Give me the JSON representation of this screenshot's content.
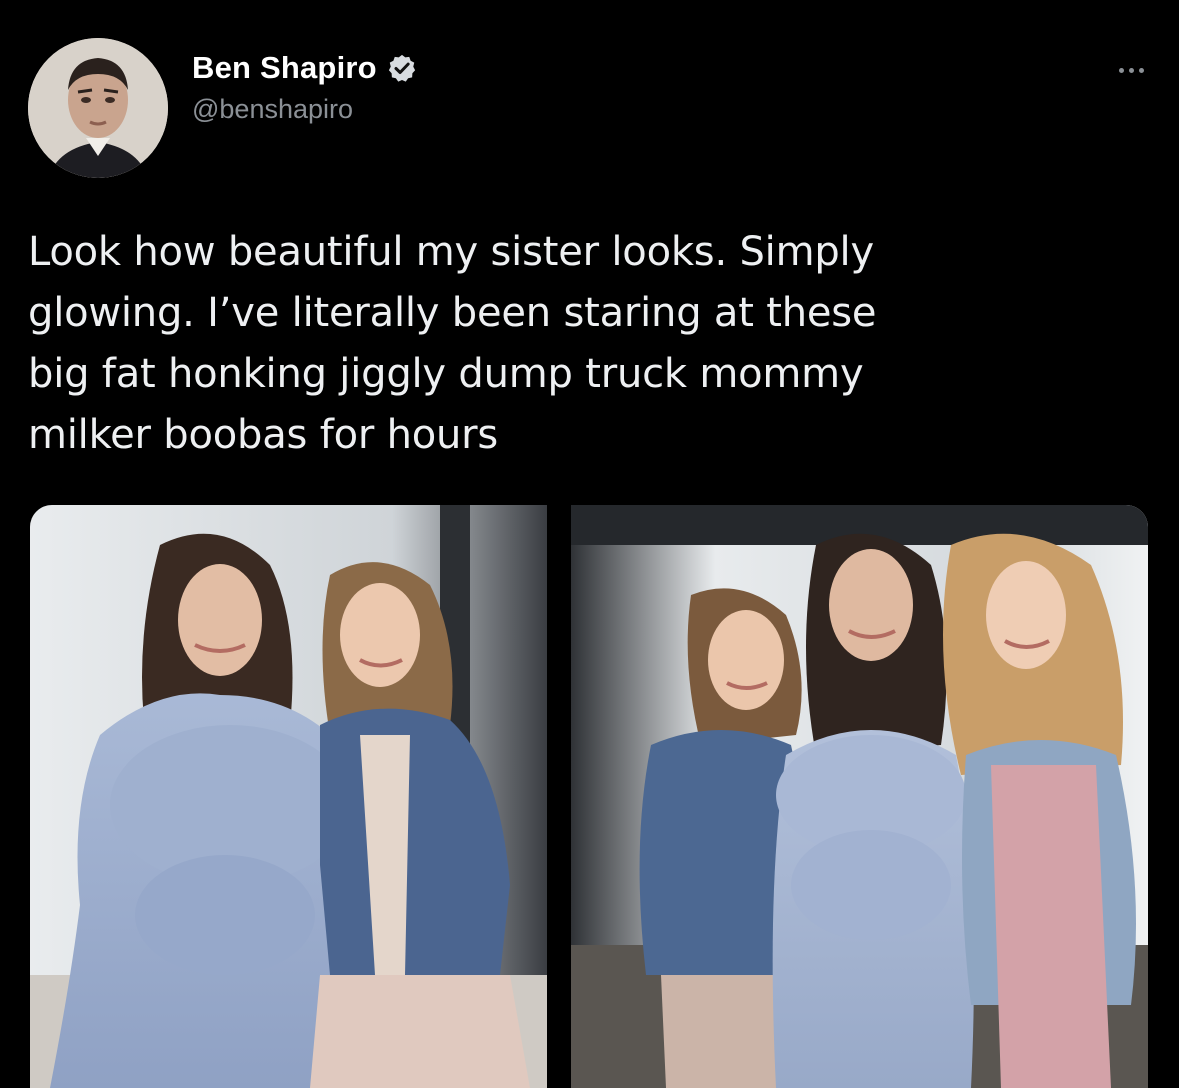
{
  "author": {
    "display_name": "Ben Shapiro",
    "handle": "@benshapiro",
    "verified": true,
    "avatar_icon": "profile-photo"
  },
  "more_icon": "ellipsis-icon",
  "tweet": {
    "lines": [
      "Look how beautiful my sister looks. Simply",
      "glowing. I’ve literally been staring at these",
      "big fat honking jiggly dump truck mommy",
      "milker boobas for hours"
    ]
  },
  "media": {
    "photo_count": 2
  },
  "colors": {
    "background": "#000000",
    "text": "#e7e9ea",
    "secondary": "#8b9096",
    "verified": "#1d9bf0"
  }
}
